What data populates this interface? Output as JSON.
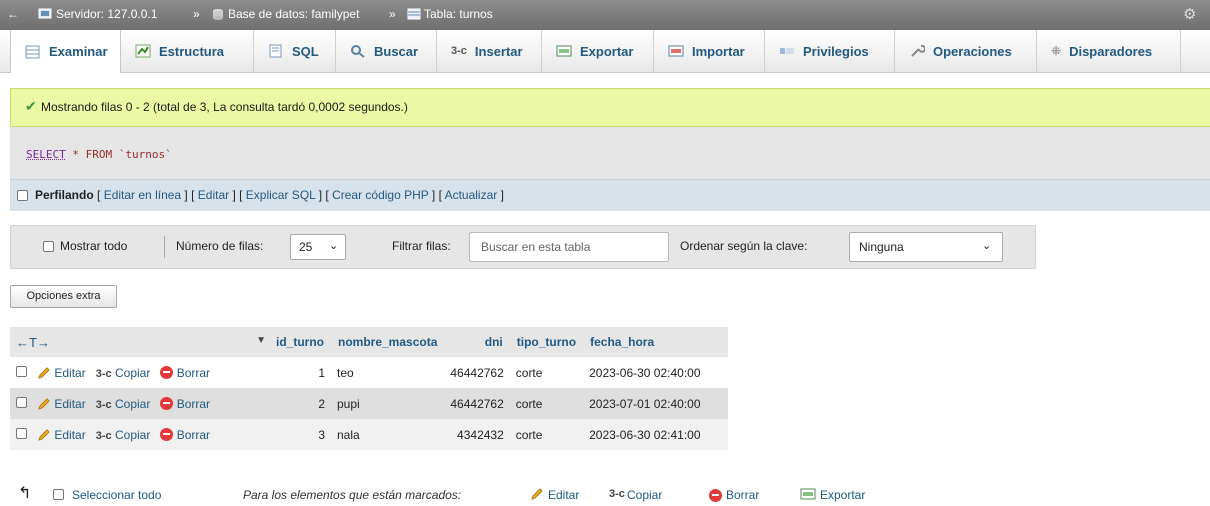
{
  "topbar": {
    "server": "Servidor: 127.0.0.1",
    "database": "Base de datos: familypet",
    "table": "Tabla: turnos",
    "sep": "»"
  },
  "tabs": [
    {
      "label": "Examinar",
      "icon": "browse-icon"
    },
    {
      "label": "Estructura",
      "icon": "structure-icon"
    },
    {
      "label": "SQL",
      "icon": "sql-icon"
    },
    {
      "label": "Buscar",
      "icon": "search-icon"
    },
    {
      "label": "Insertar",
      "icon": "insert-icon"
    },
    {
      "label": "Exportar",
      "icon": "export-icon"
    },
    {
      "label": "Importar",
      "icon": "import-icon"
    },
    {
      "label": "Privilegios",
      "icon": "privileges-icon"
    },
    {
      "label": "Operaciones",
      "icon": "operations-icon"
    },
    {
      "label": "Disparadores",
      "icon": "triggers-icon"
    }
  ],
  "success_message": "Mostrando filas 0 - 2 (total de 3, La consulta tardó 0,0002 segundos.)",
  "sql": {
    "select": "SELECT",
    "rest": "* FROM `turnos`"
  },
  "profiling": {
    "label": "Perfilando",
    "links": [
      "Editar en línea",
      "Editar",
      "Explicar SQL",
      "Crear código PHP",
      "Actualizar"
    ]
  },
  "navigation": {
    "show_all": "Mostrar todo",
    "rows_label": "Número de filas:",
    "rows_value": "25",
    "filter_label": "Filtrar filas:",
    "filter_placeholder": "Buscar en esta tabla",
    "sort_label": "Ordenar según la clave:",
    "sort_value": "Ninguna"
  },
  "extra_options": "Opciones extra",
  "table": {
    "arrows": "←T→",
    "columns": [
      "id_turno",
      "nombre_mascota",
      "dni",
      "tipo_turno",
      "fecha_hora"
    ],
    "actions": {
      "edit": "Editar",
      "copy": "Copiar",
      "delete": "Borrar"
    },
    "rows": [
      {
        "id_turno": "1",
        "nombre_mascota": "teo",
        "dni": "46442762",
        "tipo_turno": "corte",
        "fecha_hora": "2023-06-30 02:40:00"
      },
      {
        "id_turno": "2",
        "nombre_mascota": "pupi",
        "dni": "46442762",
        "tipo_turno": "corte",
        "fecha_hora": "2023-07-01 02:40:00"
      },
      {
        "id_turno": "3",
        "nombre_mascota": "nala",
        "dni": "4342432",
        "tipo_turno": "corte",
        "fecha_hora": "2023-06-30 02:41:00"
      }
    ]
  },
  "bulk": {
    "select_all": "Seleccionar todo",
    "marked_label": "Para los elementos que están marcados:",
    "edit": "Editar",
    "copy": "Copiar",
    "delete": "Borrar",
    "export": "Exportar"
  },
  "colors": {
    "link": "#235a81",
    "success_bg": "#ebf8a4",
    "profiling_bg": "#d8e2eb"
  }
}
